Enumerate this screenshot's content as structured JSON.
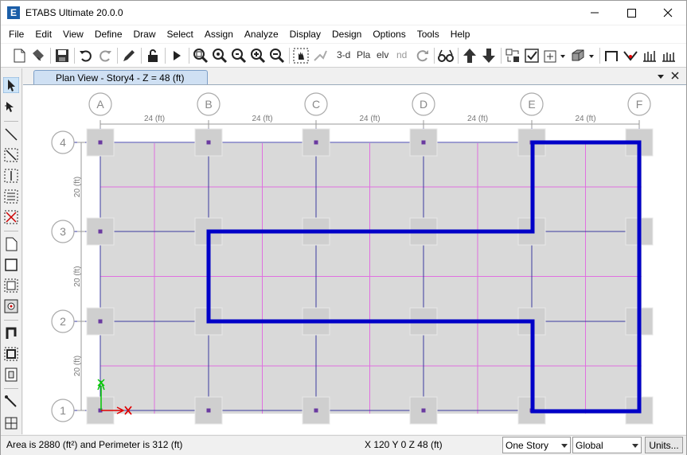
{
  "window": {
    "title": "ETABS Ultimate 20.0.0",
    "app_icon_letter": "E"
  },
  "menu": [
    "File",
    "Edit",
    "View",
    "Define",
    "Draw",
    "Select",
    "Assign",
    "Analyze",
    "Display",
    "Design",
    "Options",
    "Tools",
    "Help"
  ],
  "toolbar": {
    "text_3d": "3-d",
    "text_pla": "Pla",
    "text_elv": "elv",
    "text_nd": "nd"
  },
  "tab": {
    "title": "Plan View - Story4 - Z = 48 (ft)"
  },
  "grid": {
    "x_labels": [
      "A",
      "B",
      "C",
      "D",
      "E",
      "F"
    ],
    "y_labels": [
      "1",
      "2",
      "3",
      "4"
    ],
    "x_spacing_label": "24 (ft)",
    "y_spacing_label": "20 (ft)"
  },
  "status": {
    "area_text": "Area is 2880 (ft²) and Perimeter is 312 (ft)",
    "coord_text": "X 120  Y 0  Z 48 (ft)",
    "story_select": "One Story",
    "coord_system_select": "Global",
    "units_button": "Units..."
  },
  "colors": {
    "polygon": "#0000c8",
    "gridline": "#3a3aa0",
    "subgrid": "#e070e0",
    "slab": "#d9d9d9",
    "axis_y": "#00c800",
    "axis_x": "#e00000"
  }
}
